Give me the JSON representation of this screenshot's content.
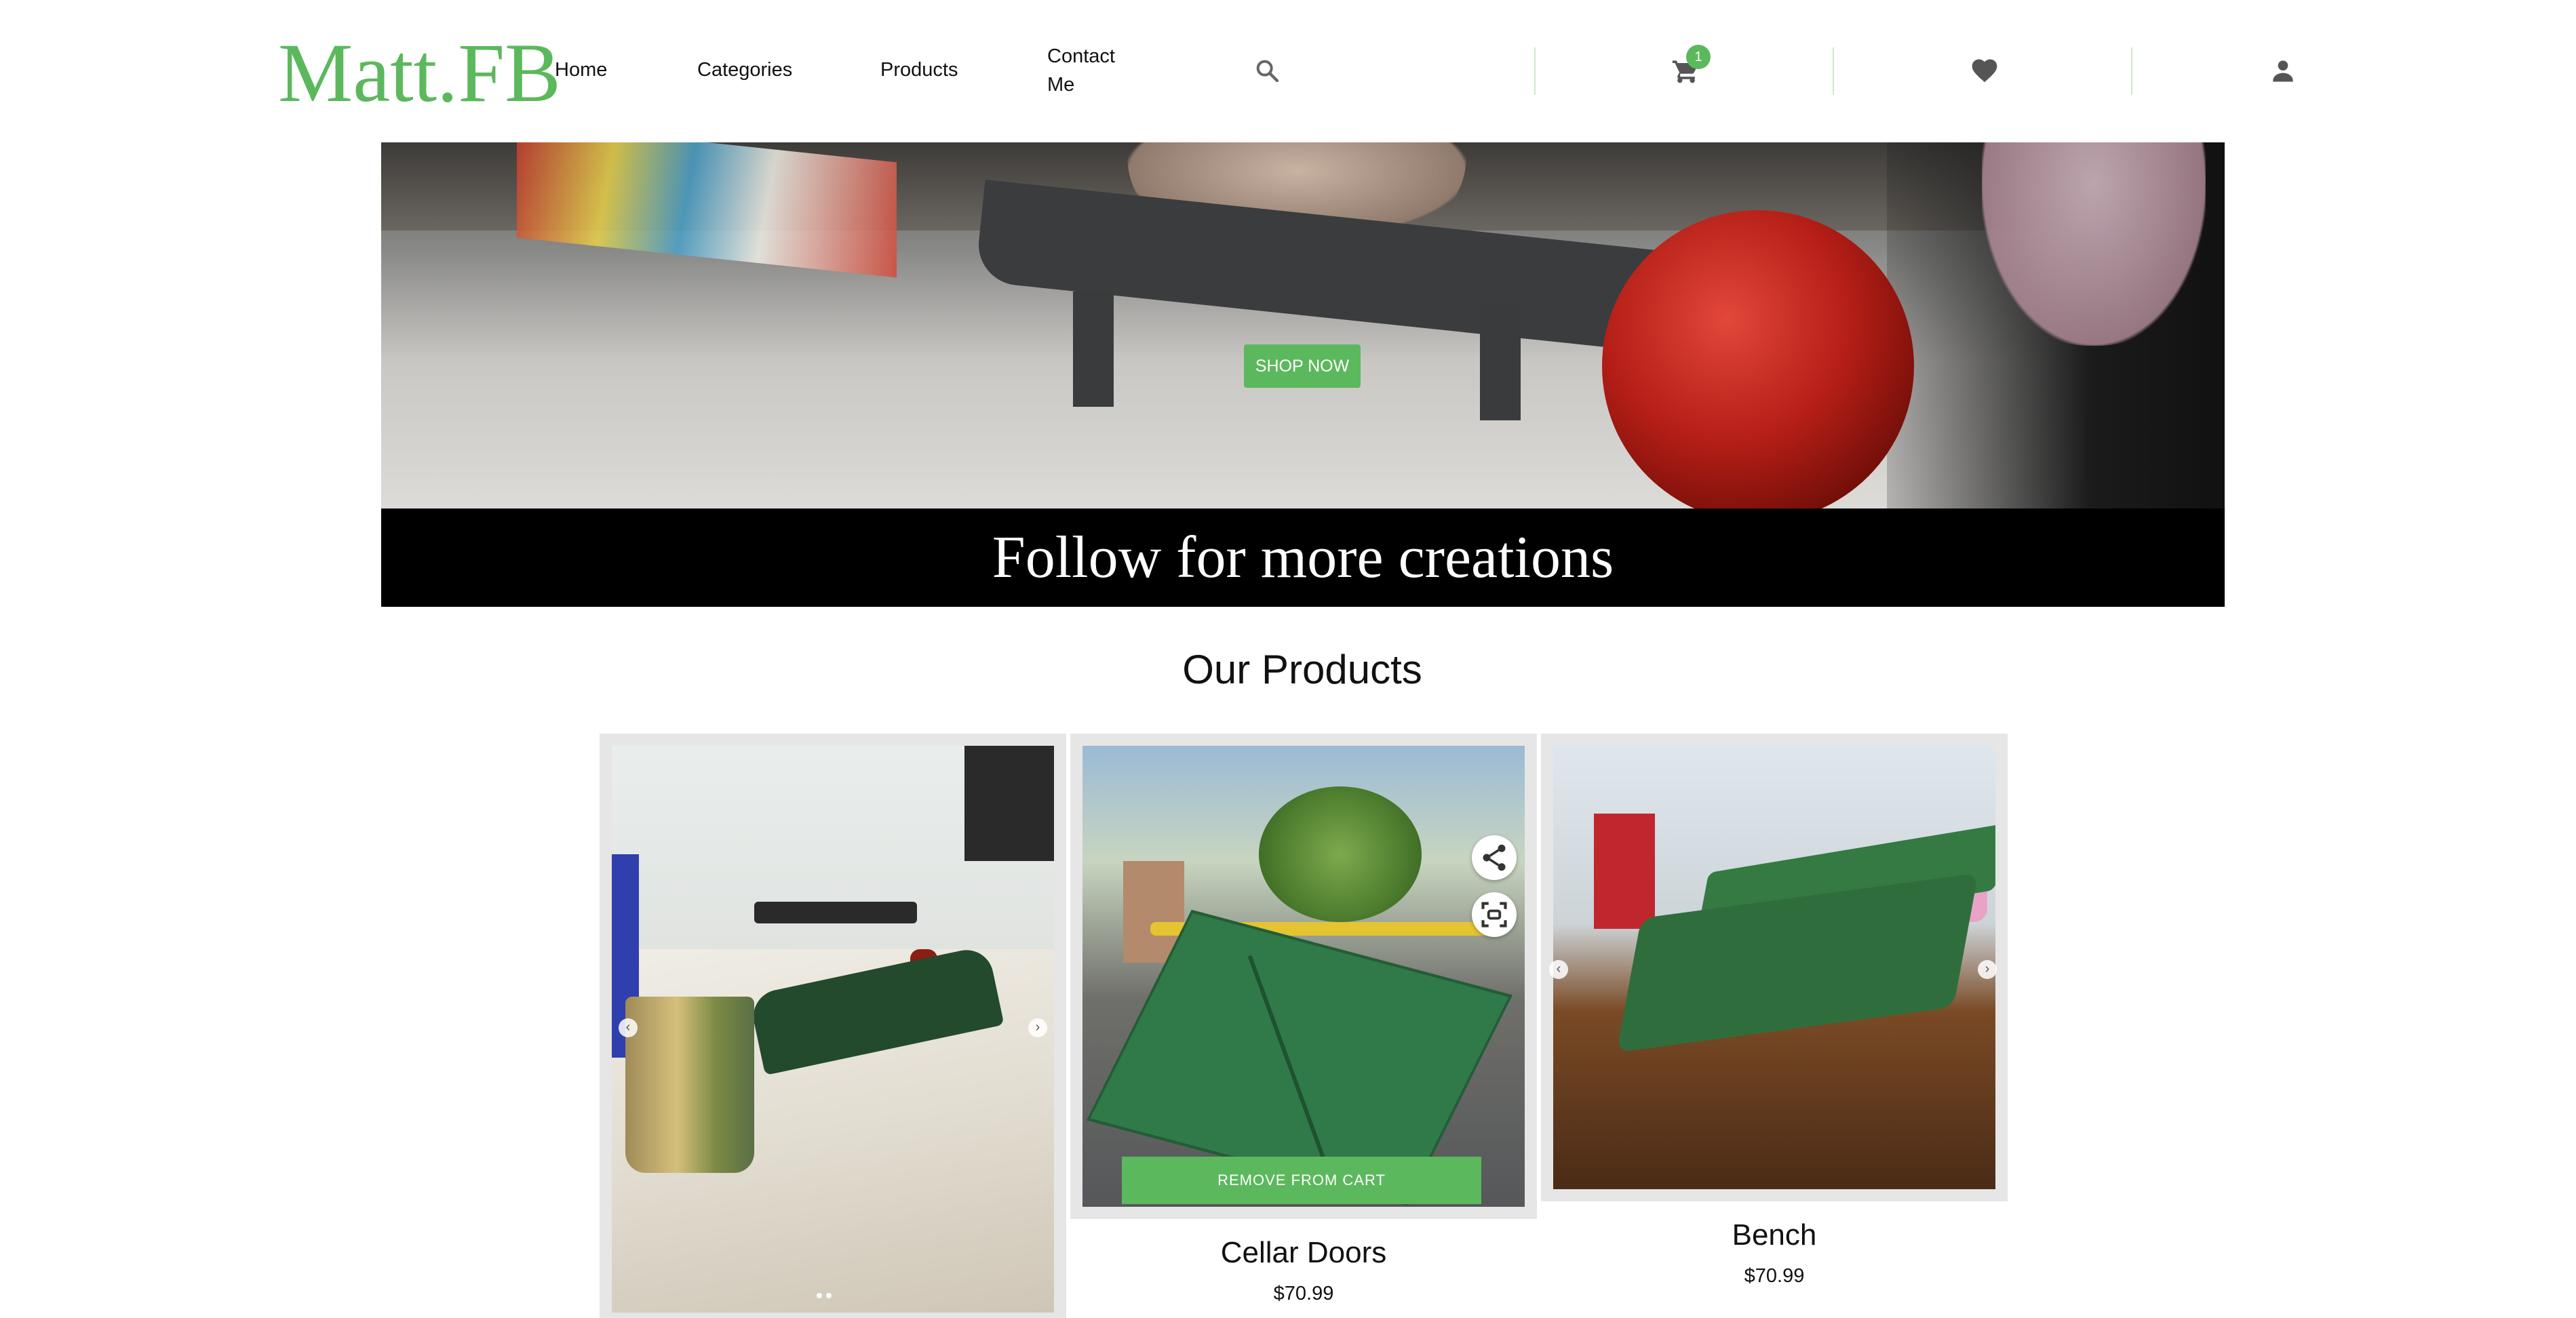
{
  "brand": {
    "logo": "Matt.FB",
    "accent_color": "#5cb85c"
  },
  "nav": {
    "home": "Home",
    "categories": "Categories",
    "products": "Products",
    "contact": "Contact Me"
  },
  "header_icons": {
    "search": "search-icon",
    "cart": "cart-icon",
    "cart_count": "1",
    "wishlist": "heart-icon",
    "account": "user-icon"
  },
  "hero": {
    "cta_label": "SHOP NOW",
    "caption": "Follow for more creations"
  },
  "products_section": {
    "title": "Our Products",
    "items": [
      {
        "name": "",
        "price": ""
      },
      {
        "name": "Cellar Doors",
        "price": "$70.99",
        "action_label": "REMOVE FROM CART"
      },
      {
        "name": "Bench",
        "price": "$70.99"
      }
    ]
  }
}
